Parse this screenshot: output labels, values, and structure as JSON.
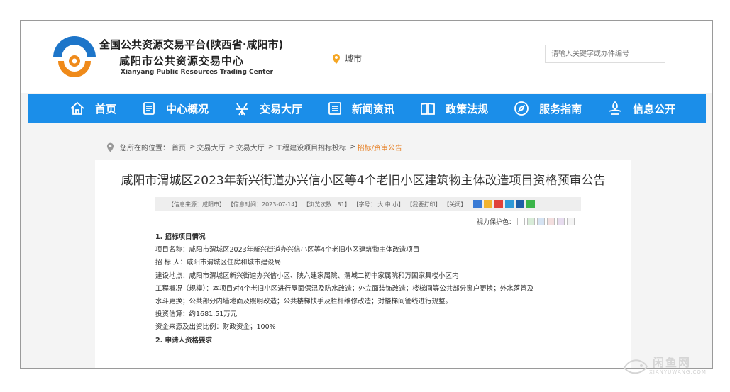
{
  "header": {
    "platform_line1": "全国公共资源交易平台(陕西省·咸阳市)",
    "center_name": "咸阳市公共资源交易中心",
    "center_name_en": "Xianyang Public Resources Trading Center",
    "city_label": "城市",
    "search_placeholder": "请输入关键字或办件编号"
  },
  "nav": {
    "items": [
      {
        "label": "首页",
        "icon": "home-icon"
      },
      {
        "label": "中心概况",
        "icon": "document-icon"
      },
      {
        "label": "交易大厅",
        "icon": "hall-icon"
      },
      {
        "label": "新闻资讯",
        "icon": "news-icon"
      },
      {
        "label": "政策法规",
        "icon": "book-icon"
      },
      {
        "label": "服务指南",
        "icon": "compass-icon"
      },
      {
        "label": "信息公开",
        "icon": "info-icon"
      }
    ]
  },
  "breadcrumb": {
    "prefix": "您所在的位置：",
    "items": [
      "首页",
      "交易大厅",
      "交易大厅",
      "工程建设项目招标投标",
      "招标/资审公告"
    ]
  },
  "article": {
    "title": "咸阳市渭城区2023年新兴街道办兴信小区等4个老旧小区建筑物主体改造项目资格预审公告",
    "meta": {
      "source": "【信息来源：咸阳市】",
      "time": "【信息时间：2023-07-14】",
      "views": "【浏览次数：81】",
      "font": "【字号： 大 中 小】",
      "print": "【我要打印】",
      "close": "【关闭】"
    },
    "eye_protection_label": "视力保护色：",
    "eye_colors": [
      "#ffffff",
      "#d8ecd8",
      "#d5e3f3",
      "#f3dede",
      "#e7dcef",
      "#f4f4f4"
    ],
    "section1": "1. 招标项目情况",
    "lines": [
      "项目名称：咸阳市渭城区2023年新兴街道办兴信小区等4个老旧小区建筑物主体改造项目",
      "招 标 人：咸阳市渭城区住房和城市建设局",
      "建设地点：咸阳市渭城区新兴街道办兴信小区、陕六建家属院、渭城二初中家属院和万国家具楼小区内",
      "工程概况（规模）：本项目对4个老旧小区进行屋面保温及防水改造；外立面装饰改造；楼梯间等公共部分窗户更换；外水落管及",
      "水斗更换；公共部分内墙地面及照明改造；公共楼梯扶手及栏杆维修改造；对楼梯间管线进行规整。",
      "投资估算：约1681.51万元",
      "资金来源及出资比例：财政资金；100%"
    ],
    "section2": "2. 申请人资格要求"
  },
  "watermark": {
    "text": "闲鱼网",
    "sub": "XIANYUWANG.COM"
  },
  "colors": {
    "nav_blue": "#1b8ee9",
    "accent_orange": "#e67e22",
    "logo_blue": "#1d75c9"
  }
}
